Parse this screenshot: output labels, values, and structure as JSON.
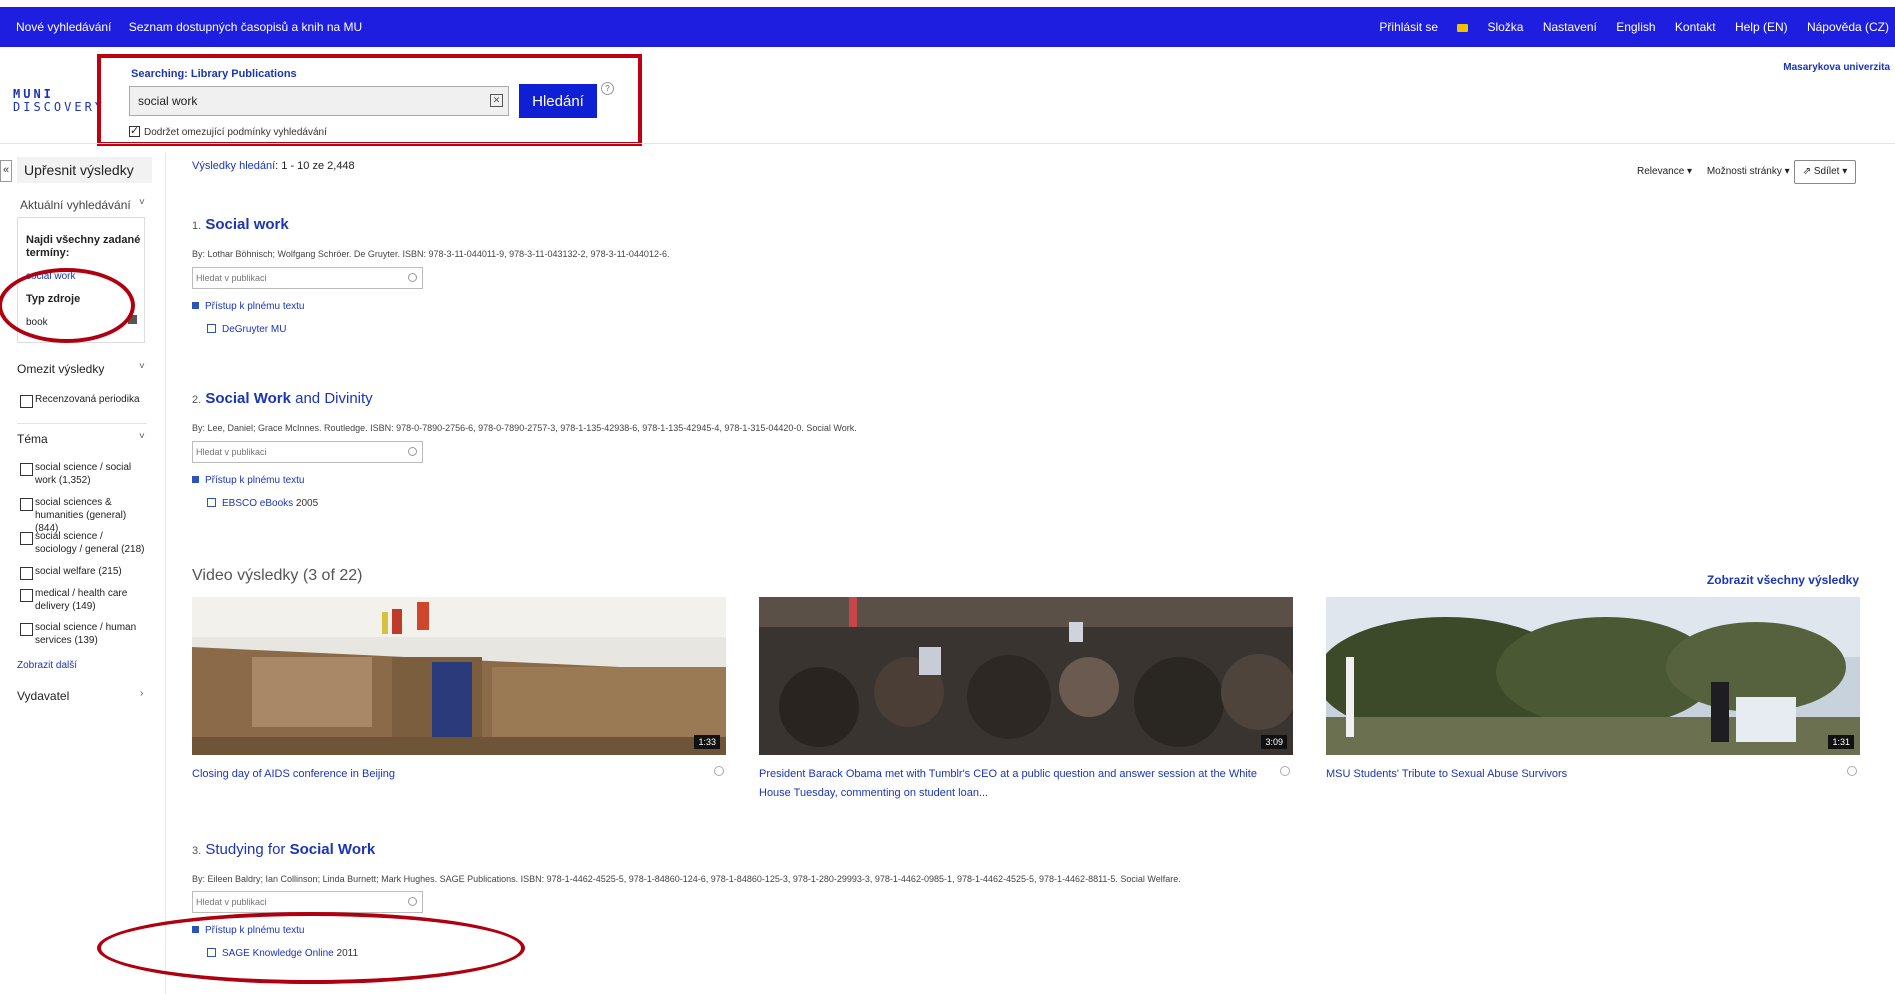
{
  "topnav": {
    "left": [
      "Nové vyhledávání",
      "Seznam dostupných časopisů a knih na MU"
    ],
    "login": "Přihlásit se",
    "folder": "Složka",
    "right": [
      "Nastavení",
      "English",
      "Kontakt",
      "Help (EN)",
      "Nápověda (CZ)"
    ]
  },
  "logo": {
    "line1": "MUNI",
    "line2": "DISCOVERY"
  },
  "search": {
    "scope_label": "Searching: Library Publications",
    "query": "social work",
    "button": "Hledání",
    "help": "?",
    "keep_conditions": "Dodržet omezující podmínky vyhledávání"
  },
  "university": "Masarykova univerzita",
  "sidebar": {
    "collapse": "«",
    "title": "Upřesnit výsledky",
    "current_search": "Aktuální vyhledávání",
    "find_all_terms": "Najdi všechny zadané termíny:",
    "term": "social work",
    "source_type": "Typ zdroje",
    "source_value": "book",
    "limit_title": "Omezit výsledky",
    "limit_items": [
      "Recenzovaná periodika"
    ],
    "topic_title": "Téma",
    "topic_items": [
      "social science / social work (1,352)",
      "social sciences & humanities (general) (844)",
      "social science / sociology / general (218)",
      "social welfare (215)",
      "medical / health care delivery (149)",
      "social science / human services (139)"
    ],
    "show_more": "Zobrazit další",
    "publisher_title": "Vydavatel"
  },
  "results": {
    "info_label": "Výsledky hledání",
    "info_value": ": 1 - 10 ze 2,448",
    "controls": [
      "Relevance ▾",
      "Možnosti stránky ▾"
    ],
    "share": "Sdílet ▾",
    "pub_search_placeholder": "Hledat v publikaci",
    "fulltext": "Přístup k plnému textu",
    "items": [
      {
        "num": "1.",
        "title_bold": "Social work",
        "title_rest": "",
        "meta": "By: Lothar Böhnisch; Wolfgang Schröer. De Gruyter. ISBN: 978-3-11-044011-9, 978-3-11-043132-2, 978-3-11-044012-6.",
        "provider": "DeGruyter MU",
        "year": ""
      },
      {
        "num": "2.",
        "title_bold": "Social Work",
        "title_rest": " and Divinity",
        "meta": "By: Lee, Daniel; Grace McInnes. Routledge. ISBN: 978-0-7890-2756-6, 978-0-7890-2757-3, 978-1-135-42938-6, 978-1-135-42945-4, 978-1-315-04420-0. Social Work.",
        "provider": "EBSCO eBooks",
        "year": " 2005"
      },
      {
        "num": "3.",
        "title_pre": "Studying for ",
        "title_bold": "Social Work",
        "meta": "By: Eileen Baldry; Ian Collinson; Linda Burnett; Mark Hughes. SAGE Publications. ISBN: 978-1-4462-4525-5, 978-1-84860-124-6, 978-1-84860-125-3, 978-1-280-29993-3, 978-1-4462-0985-1, 978-1-4462-4525-5, 978-1-4462-8811-5. Social Welfare.",
        "provider": "SAGE Knowledge Online",
        "year": " 2011"
      }
    ]
  },
  "videos": {
    "heading": "Video výsledky (3 of 22)",
    "show_all": "Zobrazit všechny výsledky",
    "items": [
      {
        "duration": "1:33",
        "caption": "Closing day of AIDS conference in Beijing"
      },
      {
        "duration": "3:09",
        "caption": "President Barack Obama met with Tumblr's CEO at a public question and answer session at the White House Tuesday, commenting on student loan..."
      },
      {
        "duration": "1:31",
        "caption": "MSU Students' Tribute to Sexual Abuse Survivors"
      }
    ]
  },
  "colors": {
    "topbar": "#1e1ee0",
    "link": "#1a35b8",
    "annotation": "#b00010"
  }
}
